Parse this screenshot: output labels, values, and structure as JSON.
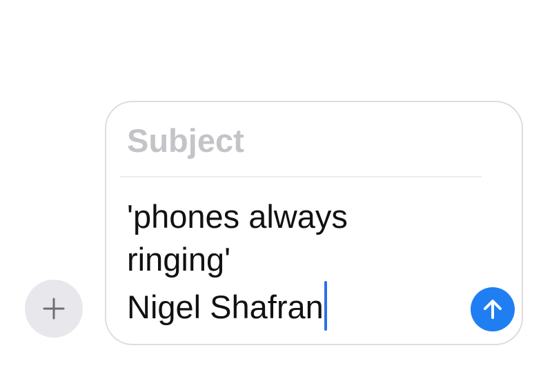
{
  "compose": {
    "subject_placeholder": "Subject",
    "message_lines": [
      "'phones always",
      "ringing'",
      "Nigel Shafran"
    ]
  },
  "icons": {
    "add": "plus-icon",
    "send": "arrow-up-icon"
  },
  "colors": {
    "accent": "#1f7ff2",
    "caret": "#2f6fe8",
    "placeholder": "#c4c4c8",
    "add_button_bg": "#e8e8ec",
    "border": "#dcdce0"
  }
}
